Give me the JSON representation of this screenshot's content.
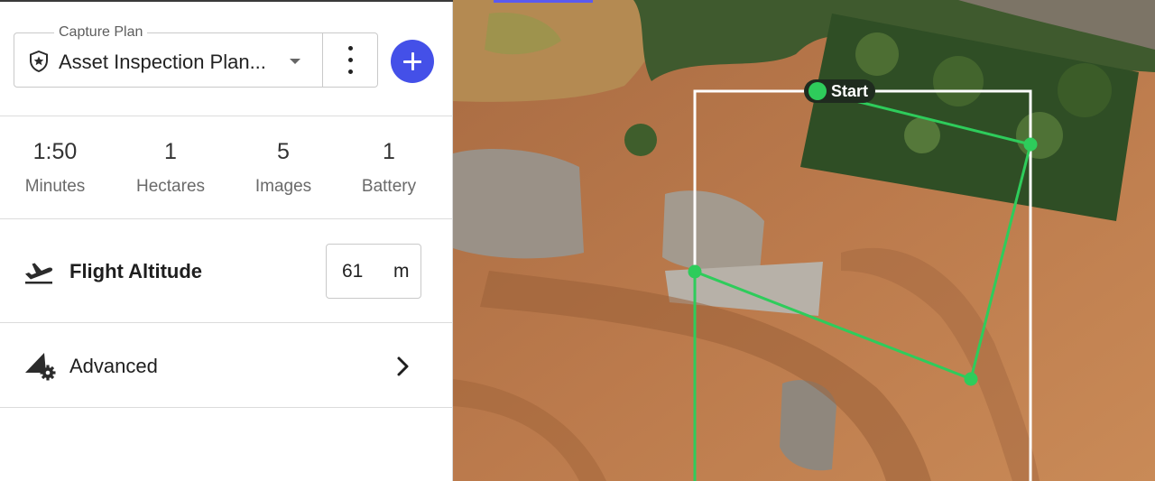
{
  "capture_plan": {
    "legend": "Capture Plan",
    "selected": "Asset Inspection Plan..."
  },
  "stats": [
    {
      "value": "1:50",
      "label": "Minutes"
    },
    {
      "value": "1",
      "label": "Hectares"
    },
    {
      "value": "5",
      "label": "Images"
    },
    {
      "value": "1",
      "label": "Battery"
    }
  ],
  "altitude": {
    "label": "Flight Altitude",
    "value": "61",
    "unit": "m"
  },
  "advanced": {
    "label": "Advanced"
  },
  "map": {
    "start_label": "Start",
    "route_color": "#2ecc5b",
    "boundary_color": "#ffffff",
    "accent_color": "#4450e8"
  }
}
